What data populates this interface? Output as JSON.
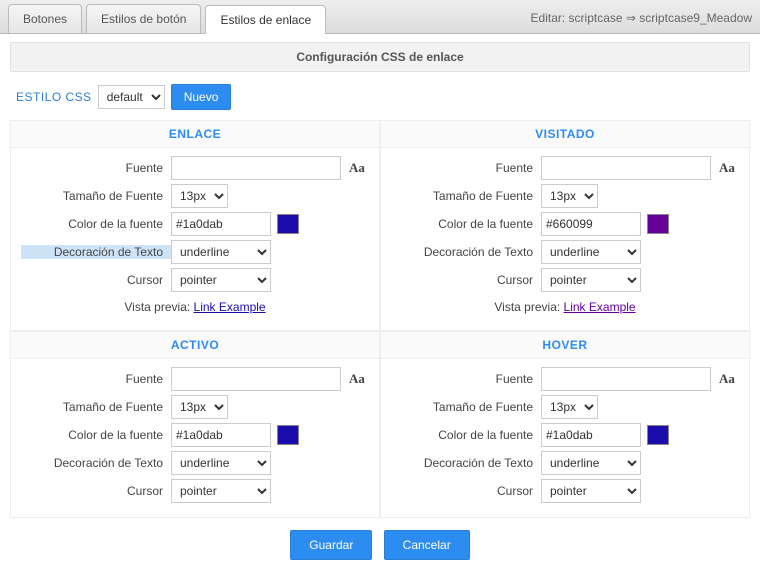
{
  "tabs": {
    "botones": "Botones",
    "estilos_boton": "Estilos de botón",
    "estilos_enlace": "Estilos de enlace"
  },
  "breadcrumb": "Editar: scriptcase ⇒ scriptcase9_Meadow",
  "panel_title": "Configuración CSS de enlace",
  "toolbar": {
    "estilo_css_label": "ESTILO CSS",
    "select_value": "default",
    "nuevo": "Nuevo"
  },
  "labels": {
    "fuente": "Fuente",
    "tamano": "Tamaño de Fuente",
    "color": "Color de la fuente",
    "decoracion": "Decoración de Texto",
    "cursor": "Cursor",
    "vista_previa": "Vista previa:",
    "link_example": "Link Example"
  },
  "sections": {
    "enlace": {
      "title": "ENLACE",
      "fuente": "",
      "tamano": "13px",
      "color": "#1a0dab",
      "swatch": "#1a0dab",
      "decoracion": "underline",
      "cursor": "pointer"
    },
    "visitado": {
      "title": "VISITADO",
      "fuente": "",
      "tamano": "13px",
      "color": "#660099",
      "swatch": "#660099",
      "decoracion": "underline",
      "cursor": "pointer"
    },
    "activo": {
      "title": "ACTIVO",
      "fuente": "",
      "tamano": "13px",
      "color": "#1a0dab",
      "swatch": "#1a0dab",
      "decoracion": "underline",
      "cursor": "pointer"
    },
    "hover": {
      "title": "HOVER",
      "fuente": "",
      "tamano": "13px",
      "color": "#1a0dab",
      "swatch": "#1a0dab",
      "decoracion": "underline",
      "cursor": "pointer"
    }
  },
  "footer": {
    "guardar": "Guardar",
    "cancelar": "Cancelar"
  }
}
